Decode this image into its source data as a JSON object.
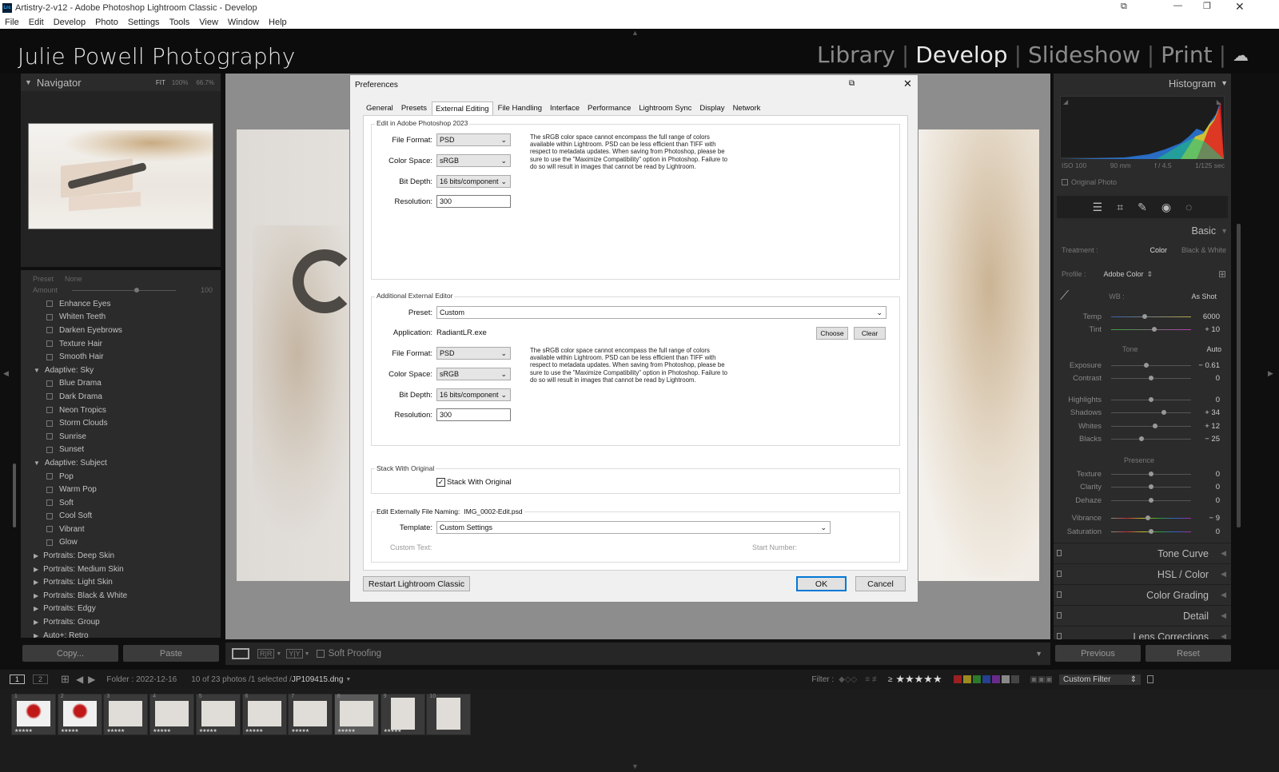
{
  "window": {
    "title": "Artistry-2-v12 - Adobe Photoshop Lightroom Classic - Develop",
    "app_icon": "Lrc"
  },
  "menu": [
    "File",
    "Edit",
    "Develop",
    "Photo",
    "Settings",
    "Tools",
    "View",
    "Window",
    "Help"
  ],
  "identity_plate": "Julie Powell Photography",
  "modules": [
    "Library",
    "Develop",
    "Slideshow",
    "Print"
  ],
  "navigator": {
    "title": "Navigator",
    "fit": "FIT",
    "z1": "100%",
    "z2": "66.7%"
  },
  "presets": {
    "preset_label": "Preset",
    "preset_value": "None",
    "amount_label": "Amount",
    "amount_value": "100",
    "rows": [
      {
        "t": "item",
        "label": "Enhance Eyes"
      },
      {
        "t": "item",
        "label": "Whiten Teeth"
      },
      {
        "t": "item",
        "label": "Darken Eyebrows"
      },
      {
        "t": "item",
        "label": "Texture Hair"
      },
      {
        "t": "item",
        "label": "Smooth Hair"
      },
      {
        "t": "open",
        "label": "Adaptive: Sky"
      },
      {
        "t": "item",
        "label": "Blue Drama"
      },
      {
        "t": "item",
        "label": "Dark Drama"
      },
      {
        "t": "item",
        "label": "Neon Tropics"
      },
      {
        "t": "item",
        "label": "Storm Clouds"
      },
      {
        "t": "item",
        "label": "Sunrise"
      },
      {
        "t": "item",
        "label": "Sunset"
      },
      {
        "t": "open",
        "label": "Adaptive: Subject"
      },
      {
        "t": "item",
        "label": "Pop"
      },
      {
        "t": "item",
        "label": "Warm Pop"
      },
      {
        "t": "item",
        "label": "Soft"
      },
      {
        "t": "item",
        "label": "Cool Soft"
      },
      {
        "t": "item",
        "label": "Vibrant"
      },
      {
        "t": "item",
        "label": "Glow"
      },
      {
        "t": "closed",
        "label": "Portraits: Deep Skin"
      },
      {
        "t": "closed",
        "label": "Portraits: Medium Skin"
      },
      {
        "t": "closed",
        "label": "Portraits: Light Skin"
      },
      {
        "t": "closed",
        "label": "Portraits: Black & White"
      },
      {
        "t": "closed",
        "label": "Portraits: Edgy"
      },
      {
        "t": "closed",
        "label": "Portraits: Group"
      },
      {
        "t": "closed",
        "label": "Auto+: Retro"
      }
    ],
    "copy": "Copy...",
    "paste": "Paste"
  },
  "toolbar": {
    "soft_proofing": "Soft Proofing"
  },
  "histogram": {
    "title": "Histogram",
    "iso": "ISO 100",
    "focal": "90 mm",
    "aperture": "f / 4.5",
    "shutter": "1/125 sec",
    "original": "Original Photo"
  },
  "basic": {
    "title": "Basic",
    "treatment": "Treatment :",
    "color": "Color",
    "bw": "Black & White",
    "profile_label": "Profile :",
    "profile": "Adobe Color",
    "wb_label": "WB :",
    "wb": "As Shot",
    "tone": "Tone",
    "auto": "Auto",
    "presence": "Presence",
    "wb_sliders": [
      {
        "label": "Temp",
        "value": "6000",
        "pos": 0.42
      },
      {
        "label": "Tint",
        "value": "+ 10",
        "pos": 0.54
      }
    ],
    "tone_sliders": [
      {
        "label": "Exposure",
        "value": "− 0.61",
        "pos": 0.44
      },
      {
        "label": "Contrast",
        "value": "0",
        "pos": 0.5
      },
      {
        "label": "Highlights",
        "value": "0",
        "pos": 0.5
      },
      {
        "label": "Shadows",
        "value": "+ 34",
        "pos": 0.66
      },
      {
        "label": "Whites",
        "value": "+ 12",
        "pos": 0.55
      },
      {
        "label": "Blacks",
        "value": "− 25",
        "pos": 0.38
      }
    ],
    "presence_sliders": [
      {
        "label": "Texture",
        "value": "0",
        "pos": 0.5
      },
      {
        "label": "Clarity",
        "value": "0",
        "pos": 0.5
      },
      {
        "label": "Dehaze",
        "value": "0",
        "pos": 0.5
      },
      {
        "label": "Vibrance",
        "value": "− 9",
        "pos": 0.46
      },
      {
        "label": "Saturation",
        "value": "0",
        "pos": 0.5
      }
    ]
  },
  "right_sections": [
    "Tone Curve",
    "HSL / Color",
    "Color Grading",
    "Detail",
    "Lens Corrections"
  ],
  "right_buttons": {
    "previous": "Previous",
    "reset": "Reset"
  },
  "filmstrip_bar": {
    "page1": "1",
    "page2": "2",
    "folder": "Folder : 2022-12-16",
    "count": "10 of 23 photos /1 selected /",
    "file": "JP109415.dng",
    "filter": "Filter :",
    "rating_op": "≥",
    "stars": "★★★★★",
    "custom_filter": "Custom Filter"
  },
  "filmstrip": [
    {
      "n": "1",
      "stars": "★★★★★",
      "red": true
    },
    {
      "n": "2",
      "stars": "★★★★★",
      "red": true
    },
    {
      "n": "3",
      "stars": "★★★★★"
    },
    {
      "n": "4",
      "stars": "★★★★★"
    },
    {
      "n": "5",
      "stars": "★★★★★"
    },
    {
      "n": "6",
      "stars": "★★★★★"
    },
    {
      "n": "7",
      "stars": "★★★★★"
    },
    {
      "n": "8",
      "stars": "★★★★★",
      "selected": true
    },
    {
      "n": "9",
      "stars": "★★★★★",
      "tall": true
    },
    {
      "n": "10",
      "stars": "",
      "tall": true
    }
  ],
  "dialog": {
    "title": "Preferences",
    "tabs": [
      "General",
      "Presets",
      "External Editing",
      "File Handling",
      "Interface",
      "Performance",
      "Lightroom Sync",
      "Display",
      "Network"
    ],
    "active_tab": "External Editing",
    "ps_group": "Edit in Adobe Photoshop 2023",
    "file_format_label": "File Format:",
    "file_format": "PSD",
    "color_space_label": "Color Space:",
    "color_space": "sRGB",
    "bit_depth_label": "Bit Depth:",
    "bit_depth": "16 bits/component",
    "resolution_label": "Resolution:",
    "resolution": "300",
    "note": "The sRGB color space cannot encompass the full range of colors available within Lightroom. PSD can be less efficient than TIFF with respect to metadata updates. When saving from Photoshop, please be sure to use the \"Maximize Compatibility\" option in Photoshop. Failure to do so will result in images that cannot be read by Lightroom.",
    "add_group": "Additional External Editor",
    "preset_label": "Preset:",
    "preset": "Custom",
    "application_label": "Application:",
    "application": "RadiantLR.exe",
    "choose": "Choose",
    "clear": "Clear",
    "file_format2": "PSD",
    "color_space2": "sRGB",
    "bit_depth2": "16 bits/component",
    "resolution2": "300",
    "stack_group": "Stack With Original",
    "stack_label": "Stack With Original",
    "naming_group": "Edit Externally File Naming:",
    "naming_example": "IMG_0002-Edit.psd",
    "template_label": "Template:",
    "template": "Custom Settings",
    "custom_text": "Custom Text:",
    "start_number": "Start Number:",
    "restart": "Restart Lightroom Classic",
    "ok": "OK",
    "cancel": "Cancel"
  },
  "colors": {
    "accent": "#0078d7",
    "ok_border": "#0078d7",
    "histo_blue": "#2a7ae0",
    "histo_yellow": "#e8d020",
    "histo_red": "#e02020"
  }
}
